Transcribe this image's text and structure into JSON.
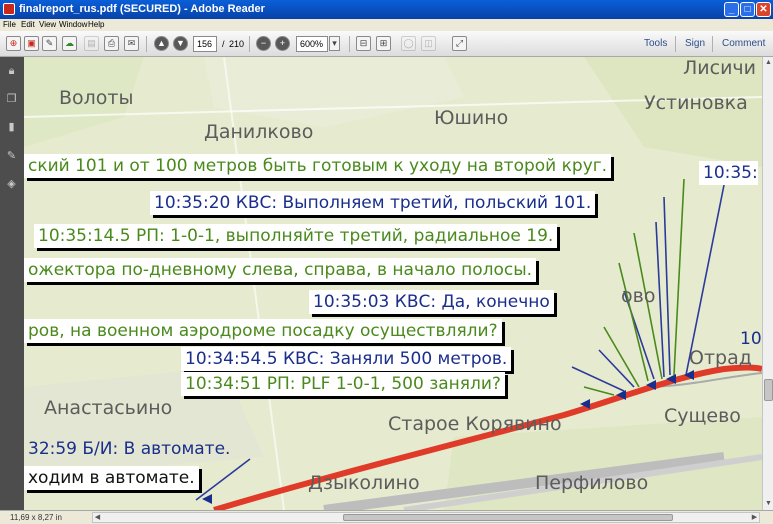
{
  "window": {
    "title": "finalreport_rus.pdf (SECURED) - Adobe Reader",
    "minimize": "_",
    "maximize": "□",
    "close": "✕"
  },
  "menu": [
    "File",
    "Edit",
    "View",
    "Window",
    "Help"
  ],
  "toolbar": {
    "page_current": "156",
    "page_separator": "/",
    "page_total": "210",
    "zoom": "600%",
    "dropdown_arrow": "▾",
    "links": [
      "Tools",
      "Sign",
      "Comment"
    ],
    "icons": [
      "create-pdf-icon",
      "open-icon",
      "edit-icon",
      "cloud-icon",
      "save-icon",
      "print-icon",
      "email-icon",
      "previous-page-icon",
      "next-page-icon",
      "zoom-out-icon",
      "zoom-in-icon",
      "fit-page-icon",
      "fit-width-icon",
      "full-screen-icon"
    ]
  },
  "left_panel": {
    "icons": [
      "lock-icon",
      "pages-icon",
      "bookmark-icon",
      "signature-icon",
      "layers-icon"
    ]
  },
  "map": {
    "places": [
      "Лисичи",
      "Волоты",
      "Устиновка",
      "Данилково",
      "Юшино",
      "ово",
      "Анастасьино",
      "Старое Корявино",
      "Сущево",
      "Дзыколино",
      "Перфилово",
      "Отрад",
      "10:35:",
      "10"
    ],
    "route_color": "#e03a28",
    "blue_text_color": "#1a2e8c",
    "green_text_color": "#4a8a1c"
  },
  "transcript": [
    {
      "text": "ский 101 и от 100 метров быть готовым к уходу на второй круг.",
      "color": "green"
    },
    {
      "text": "10:35:20 КВС: Выполняем третий, польский 101.",
      "color": "blue"
    },
    {
      "text": "10:35:14.5 РП: 1-0-1, выполняйте третий, радиальное 19.",
      "color": "green"
    },
    {
      "text": "ожектора по-дневному слева, справа, в начало полосы.",
      "color": "green"
    },
    {
      "text": "10:35:03 КВС: Да, конечно",
      "color": "blue"
    },
    {
      "text": "ров, на военном аэродроме посадку осуществляли?",
      "color": "green"
    },
    {
      "text": "10:34:54.5 КВС: Заняли 500 метров.",
      "color": "blue"
    },
    {
      "text": "10:34:51 РП: PLF 1-0-1, 500 заняли?",
      "color": "green"
    },
    {
      "text": "32:59 Б/И: В автомате.",
      "color": "blue"
    },
    {
      "text": "ходим в автомате.",
      "color": "blue"
    }
  ],
  "statusbar": {
    "page_size": "11,69 x 8,27 in"
  }
}
